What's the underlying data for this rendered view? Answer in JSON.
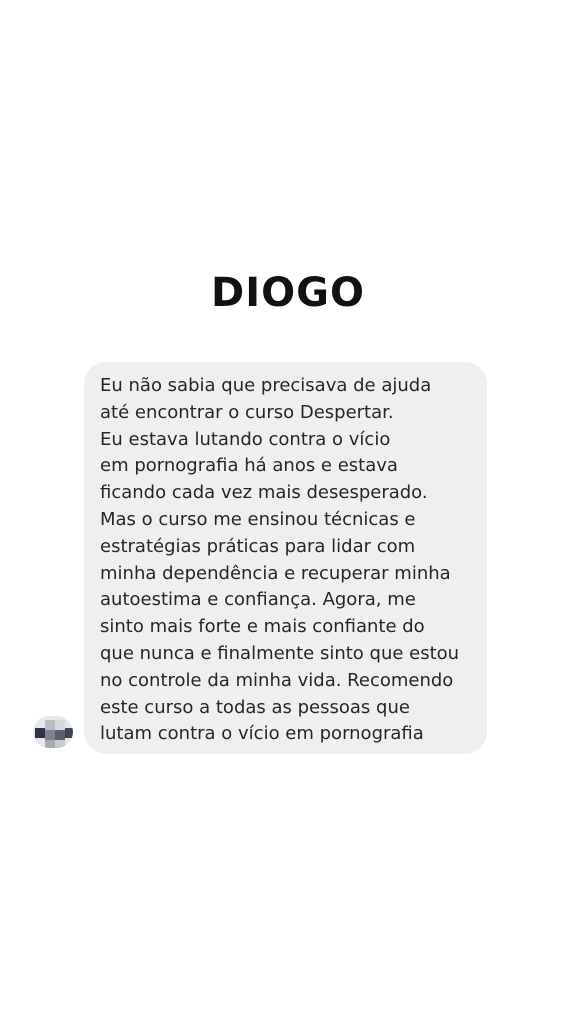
{
  "header": {
    "title": "DIOGO"
  },
  "message": {
    "lines": [
      "Eu não sabia que precisava de ajuda",
      "até encontrar o curso Despertar.",
      "Eu estava lutando contra o vício",
      "em pornografia há anos e estava",
      "ficando cada vez mais desesperado.",
      "Mas o curso me ensinou técnicas e",
      "estratégias práticas para lidar com",
      "minha dependência e recuperar minha",
      "autoestima e confiança. Agora, me",
      "sinto mais forte e mais confiante do",
      "que nunca e finalmente sinto que estou",
      "no controle da minha vida. Recomendo",
      "este curso a todas as pessoas que",
      "lutam contra o vício em pornografia"
    ]
  },
  "colors": {
    "background": "#ffffff",
    "bubble": "#efefef",
    "text": "#262626",
    "title": "#111111"
  },
  "icons": {
    "avatar": "blurred-profile-avatar"
  }
}
